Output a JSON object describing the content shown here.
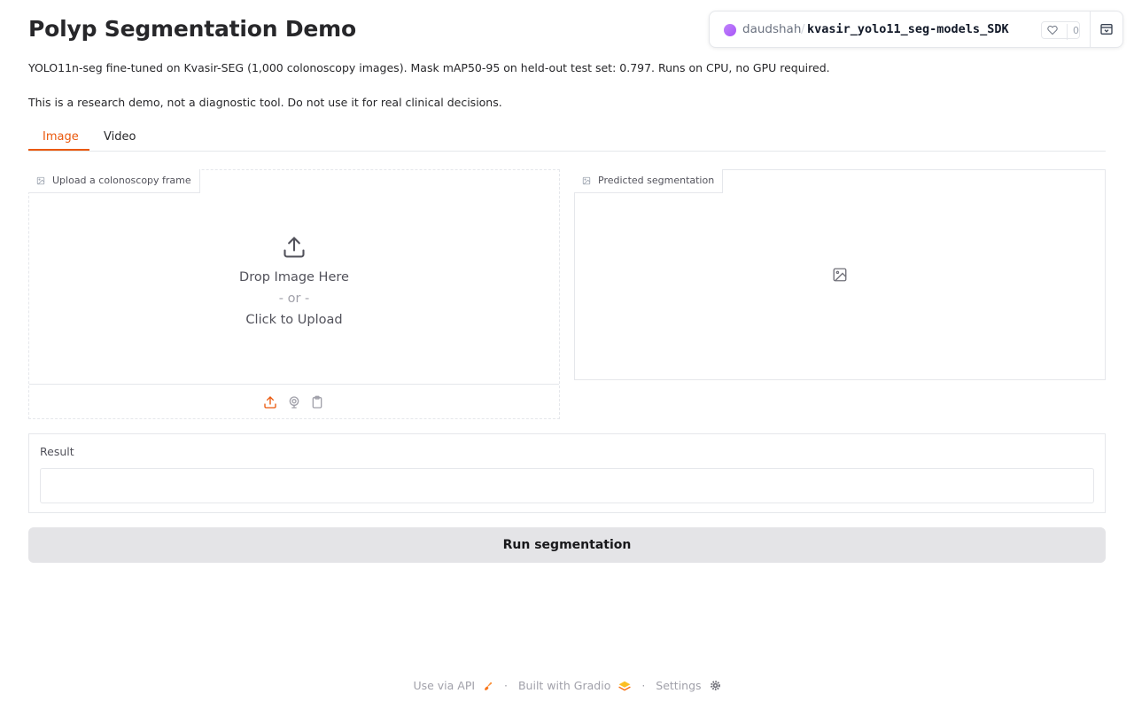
{
  "header": {
    "title": "Polyp Segmentation Demo",
    "description_1": "YOLO11n-seg fine-tuned on Kvasir-SEG (1,000 colonoscopy images). Mask mAP50-95 on held-out test set: 0.797. Runs on CPU, no GPU required.",
    "description_2": "This is a research demo, not a diagnostic tool. Do not use it for real clinical decisions."
  },
  "tabs": [
    {
      "label": "Image",
      "active": true
    },
    {
      "label": "Video",
      "active": false
    }
  ],
  "upload_panel": {
    "label": "Upload a colonoscopy frame",
    "drop_text": "Drop Image Here",
    "or_text": "- or -",
    "click_text": "Click to Upload",
    "icons": [
      "upload-icon",
      "webcam-icon",
      "clipboard-icon"
    ]
  },
  "output_panel": {
    "label": "Predicted segmentation",
    "placeholder_icon": "image-icon"
  },
  "result": {
    "label": "Result",
    "value": ""
  },
  "run_button": {
    "label": "Run segmentation"
  },
  "footer": {
    "api": "Use via API",
    "built": "Built with Gradio",
    "settings": "Settings",
    "separator": "·"
  },
  "space_bar": {
    "user": "daudshah",
    "slash": "/",
    "repo": "kvasir_yolo11_seg-models_SDK",
    "likes": "0"
  },
  "colors": {
    "accent": "#ea580c",
    "button_bg": "#e4e4e7",
    "border": "#e5e7eb"
  }
}
